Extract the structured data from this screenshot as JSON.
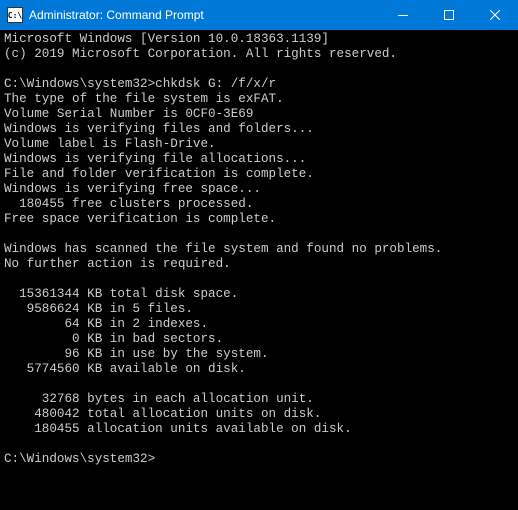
{
  "titlebar": {
    "icon_text": "C:\\",
    "title": "Administrator: Command Prompt"
  },
  "terminal": {
    "lines": [
      "Microsoft Windows [Version 10.0.18363.1139]",
      "(c) 2019 Microsoft Corporation. All rights reserved.",
      "",
      "C:\\Windows\\system32>chkdsk G: /f/x/r",
      "The type of the file system is exFAT.",
      "Volume Serial Number is 0CF0-3E69",
      "Windows is verifying files and folders...",
      "Volume label is Flash-Drive.",
      "Windows is verifying file allocations...",
      "File and folder verification is complete.",
      "Windows is verifying free space...",
      "  180455 free clusters processed.",
      "Free space verification is complete.",
      "",
      "Windows has scanned the file system and found no problems.",
      "No further action is required.",
      "",
      "  15361344 KB total disk space.",
      "   9586624 KB in 5 files.",
      "        64 KB in 2 indexes.",
      "         0 KB in bad sectors.",
      "        96 KB in use by the system.",
      "   5774560 KB available on disk.",
      "",
      "     32768 bytes in each allocation unit.",
      "    480042 total allocation units on disk.",
      "    180455 allocation units available on disk.",
      "",
      "C:\\Windows\\system32>"
    ]
  }
}
